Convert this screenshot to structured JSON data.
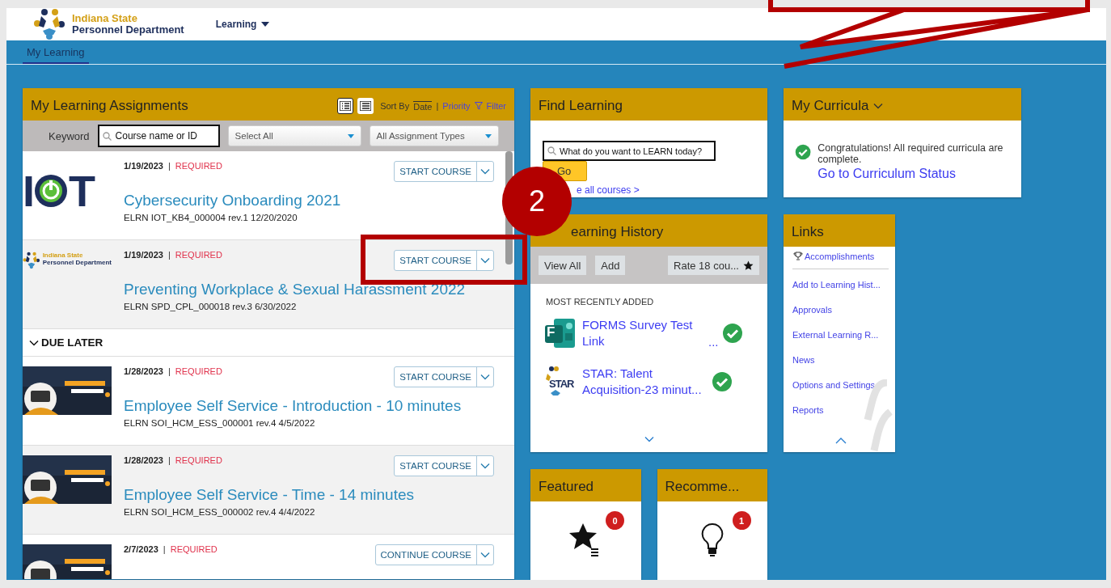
{
  "header": {
    "org_line_1": "Indiana State",
    "org_line_2": "Personnel Department",
    "menu": "Learning"
  },
  "nav": {
    "tabs": [
      {
        "label": "My Learning",
        "selected": true
      }
    ]
  },
  "assignments": {
    "title": "My Learning Assignments",
    "views": [
      {
        "kind": "detail",
        "selected": true
      },
      {
        "kind": "list",
        "selected": false
      }
    ],
    "sort_label": "Sort By",
    "sort_options": [
      {
        "label": "Date",
        "selected": true
      },
      {
        "label": "Priority",
        "selected": false
      }
    ],
    "separator": "|",
    "filter": "Filter",
    "keyword_label": "Keyword",
    "keyword_placeholder": "Course name or ID",
    "status_select": "Select All",
    "type_select": "All Assignment Types",
    "items": [
      {
        "kind": "course",
        "logo_left": "I",
        "logo_right": "T",
        "date": "1/19/2023",
        "status": "REQUIRED",
        "title": "Cybersecurity Onboarding 2021",
        "code": "ELRN IOT_KB4_000004 rev.1 12/20/2020",
        "action": "START COURSE"
      },
      {
        "kind": "course",
        "logo_line_1": "Indiana State",
        "logo_line_2": "Personnel Department",
        "date": "1/19/2023",
        "status": "REQUIRED",
        "title": "Preventing Workplace & Sexual Harassment 2022",
        "code": "ELRN SPD_CPL_000018 rev.3 6/30/2022",
        "action": "START COURSE"
      },
      {
        "kind": "group",
        "label": "DUE LATER",
        "expanded": true
      },
      {
        "kind": "course",
        "date": "1/28/2023",
        "status": "REQUIRED",
        "title": "Employee Self Service - Introduction - 10 minutes",
        "code": "ELRN SOI_HCM_ESS_000001 rev.4 4/5/2022",
        "action": "START COURSE"
      },
      {
        "kind": "course",
        "date": "1/28/2023",
        "status": "REQUIRED",
        "title": "Employee Self Service - Time - 14 minutes",
        "code": "ELRN SOI_HCM_ESS_000002 rev.4 4/4/2022",
        "action": "START COURSE"
      },
      {
        "kind": "course",
        "date": "2/7/2023",
        "status": "REQUIRED",
        "action": "CONTINUE COURSE"
      }
    ]
  },
  "find_learning": {
    "title": "Find Learning",
    "placeholder": "What do you want to LEARN today?",
    "button": "Go",
    "link": "e all courses >"
  },
  "learning_history": {
    "title": "earning History",
    "buttons": [
      "View All",
      "Add",
      "Rate 18 cou..."
    ],
    "section": "MOST RECENTLY ADDED",
    "items": [
      {
        "icon_text": "F",
        "title": "FORMS Survey Test Link",
        "ellipsis": "...",
        "completed": true
      },
      {
        "icon_text": "STAR",
        "title": "STAR: Talent Acquisition-23 minut...",
        "completed": true
      }
    ]
  },
  "curricula": {
    "title": "My Curricula",
    "message": "Congratulations! All required curricula are complete.",
    "link": "Go to Curriculum Status",
    "complete": true
  },
  "links": {
    "title": "Links",
    "items": [
      {
        "label": "Accomplishments",
        "kind": "trophy"
      },
      {
        "label": "Add to Learning Hist...",
        "kind": "plain"
      },
      {
        "label": "Approvals",
        "kind": "plain"
      },
      {
        "label": "External Learning R...",
        "kind": "plain"
      },
      {
        "label": "News",
        "kind": "plain"
      },
      {
        "label": "Options and Settings",
        "kind": "plain"
      },
      {
        "label": "Reports",
        "kind": "plain"
      }
    ]
  },
  "tiles": [
    {
      "title": "Featured",
      "count": "0"
    },
    {
      "title": "Recomme...",
      "count": "1"
    }
  ],
  "annotation": {
    "number": "2"
  }
}
